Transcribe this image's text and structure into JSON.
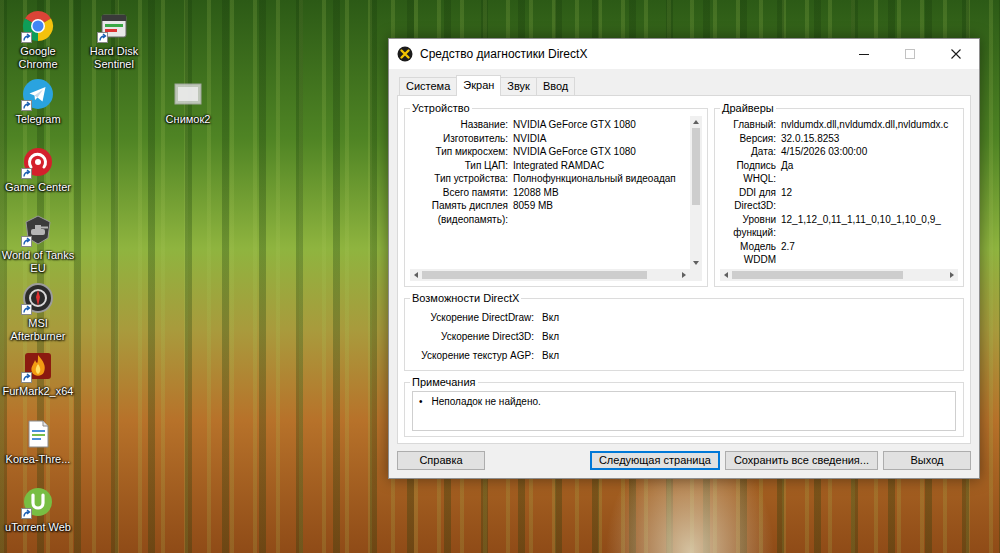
{
  "desktop": {
    "icons": [
      {
        "label": "Google Chrome",
        "kind": "chrome",
        "shortcut": true
      },
      {
        "label": "Hard Disk Sentinel",
        "kind": "disk",
        "shortcut": true
      },
      {
        "label": "Telegram",
        "kind": "telegram",
        "shortcut": true
      },
      {
        "label": "Снимок2",
        "kind": "image",
        "shortcut": false
      },
      {
        "label": "Game Center",
        "kind": "game",
        "shortcut": true
      },
      {
        "label": "World of Tanks EU",
        "kind": "tanks",
        "shortcut": true
      },
      {
        "label": "MSI Afterburner",
        "kind": "afterburner",
        "shortcut": true
      },
      {
        "label": "FurMark2_x64",
        "kind": "furmark",
        "shortcut": true
      },
      {
        "label": "Korea-Thre...",
        "kind": "document",
        "shortcut": false
      },
      {
        "label": "uTorrent Web",
        "kind": "utorrent",
        "shortcut": true
      }
    ]
  },
  "window": {
    "title": "Средство диагностики DirectX",
    "controls": [
      {
        "kind": "minimize",
        "disabled": false
      },
      {
        "kind": "maximize",
        "disabled": true
      },
      {
        "kind": "close",
        "disabled": false
      }
    ]
  },
  "tabs": [
    {
      "label": "Система",
      "selected": false
    },
    {
      "label": "Экран",
      "selected": true
    },
    {
      "label": "Звук",
      "selected": false
    },
    {
      "label": "Ввод",
      "selected": false
    }
  ],
  "device": {
    "title": "Устройство",
    "rows": [
      {
        "label": "Название:",
        "value": "NVIDIA GeForce GTX 1080"
      },
      {
        "label": "Изготовитель:",
        "value": "NVIDIA"
      },
      {
        "label": "Тип микросхем:",
        "value": "NVIDIA GeForce GTX 1080"
      },
      {
        "label": "Тип ЦАП:",
        "value": "Integrated RAMDAC"
      },
      {
        "label": "Тип устройства:",
        "value": "Полнофункциональный видеоадап"
      },
      {
        "label": "Всего памяти:",
        "value": "12088 MB"
      },
      {
        "label": "Память дисплея (видеопамять):",
        "value": "8059 MB"
      }
    ],
    "scrollbars": [
      {
        "kind": "vertical",
        "level": 0.6
      },
      {
        "kind": "horizontal",
        "level": 0.88
      }
    ]
  },
  "drivers": {
    "title": "Драйверы",
    "rows": [
      {
        "label": "Главный:",
        "value": "nvldumdx.dll,nvldumdx.dll,nvldumdx.c"
      },
      {
        "label": "Версия:",
        "value": "32.0.15.8253"
      },
      {
        "label": "Дата:",
        "value": "4/15/2026 03:00:00"
      },
      {
        "label": "Подпись WHQL:",
        "value": "Да"
      },
      {
        "label": "DDI для Direct3D:",
        "value": "12"
      },
      {
        "label": "Уровни функций:",
        "value": "12_1,12_0,11_1,11_0,10_1,10_0,9_"
      },
      {
        "label": "Модель WDDM",
        "value": "2.7"
      }
    ],
    "scrollbars": [
      {
        "kind": "horizontal",
        "level": 0.8
      }
    ]
  },
  "features": {
    "title": "Возможности DirectX",
    "rows": [
      {
        "label": "Ускорение DirectDraw:",
        "value": "Вкл"
      },
      {
        "label": "Ускорение Direct3D:",
        "value": "Вкл"
      },
      {
        "label": "Ускорение текстур AGP:",
        "value": "Вкл"
      }
    ]
  },
  "notes": {
    "title": "Примечания",
    "items": [
      {
        "bullet": "•",
        "text": "Неполадок не найдено."
      }
    ]
  },
  "buttons": [
    {
      "label": "Справка",
      "default": false
    },
    {
      "label": "Следующая страница",
      "default": true
    },
    {
      "label": "Сохранить все сведения...",
      "default": false
    },
    {
      "label": "Выход",
      "default": false
    }
  ]
}
